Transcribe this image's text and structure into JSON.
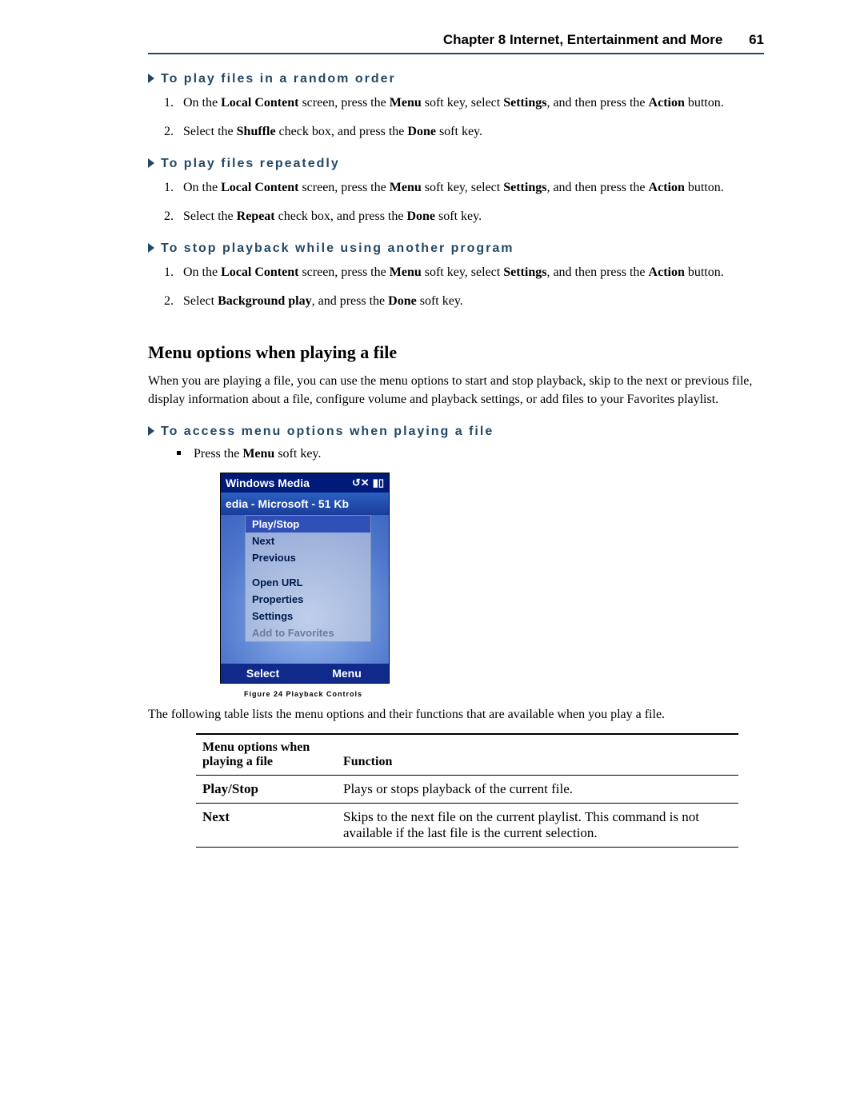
{
  "header": {
    "chapter": "Chapter 8 Internet, Entertainment and More",
    "page": "61"
  },
  "sections": {
    "s1": {
      "title": "To play files in a random order",
      "step1_a": "On the ",
      "step1_b": "Local Content",
      "step1_c": " screen, press the ",
      "step1_d": "Menu",
      "step1_e": " soft key, select ",
      "step1_f": "Settings",
      "step1_g": ", and then press the ",
      "step1_h": "Action",
      "step1_i": " button.",
      "step2_a": "Select the ",
      "step2_b": "Shuffle",
      "step2_c": " check box, and press the ",
      "step2_d": "Done",
      "step2_e": " soft key."
    },
    "s2": {
      "title": "To play files repeatedly",
      "step1_a": "On the ",
      "step1_b": "Local Content",
      "step1_c": " screen, press the ",
      "step1_d": "Menu",
      "step1_e": " soft key, select ",
      "step1_f": "Settings",
      "step1_g": ", and then press the ",
      "step1_h": "Action",
      "step1_i": " button.",
      "step2_a": "Select the ",
      "step2_b": "Repeat",
      "step2_c": " check box, and press the ",
      "step2_d": "Done",
      "step2_e": " soft key."
    },
    "s3": {
      "title": "To stop playback while using another program",
      "step1_a": "On the ",
      "step1_b": "Local Content",
      "step1_c": " screen, press the ",
      "step1_d": "Menu",
      "step1_e": " soft key, select ",
      "step1_f": "Settings",
      "step1_g": ", and then press the ",
      "step1_h": "Action",
      "step1_i": " button.",
      "step2_a": "Select ",
      "step2_b": "Background play",
      "step2_c": ", and press the ",
      "step2_d": "Done",
      "step2_e": " soft key."
    }
  },
  "mopt": {
    "heading": "Menu options when playing a file",
    "intro": "When you are playing a file, you can use the menu options to start and stop playback, skip to the next or previous file, display information about a file, configure volume and playback settings, or add files to your Favorites playlist.",
    "sub_title": "To access menu options when playing a file",
    "bullet_a": "Press the ",
    "bullet_b": "Menu",
    "bullet_c": " soft key."
  },
  "phone": {
    "title": "Windows Media",
    "subtitle": "edia - Microsoft - 51 Kb",
    "m1": "Play/Stop",
    "m2": "Next",
    "m3": "Previous",
    "m4": "Open URL",
    "m5": "Properties",
    "m6": "Settings",
    "m7": "Add to Favorites",
    "soft_left": "Select",
    "soft_right": "Menu"
  },
  "figure_caption": "Figure 24 Playback Controls",
  "table_intro": "The following table lists the menu options and their functions that are available when you play a file.",
  "table": {
    "h1": "Menu options when playing a file",
    "h2": "Function",
    "r1c1": "Play/Stop",
    "r1c2": "Plays or stops playback of the current file.",
    "r2c1": "Next",
    "r2c2": "Skips to the next file on the current playlist. This command is not available if the last file is the current selection."
  }
}
